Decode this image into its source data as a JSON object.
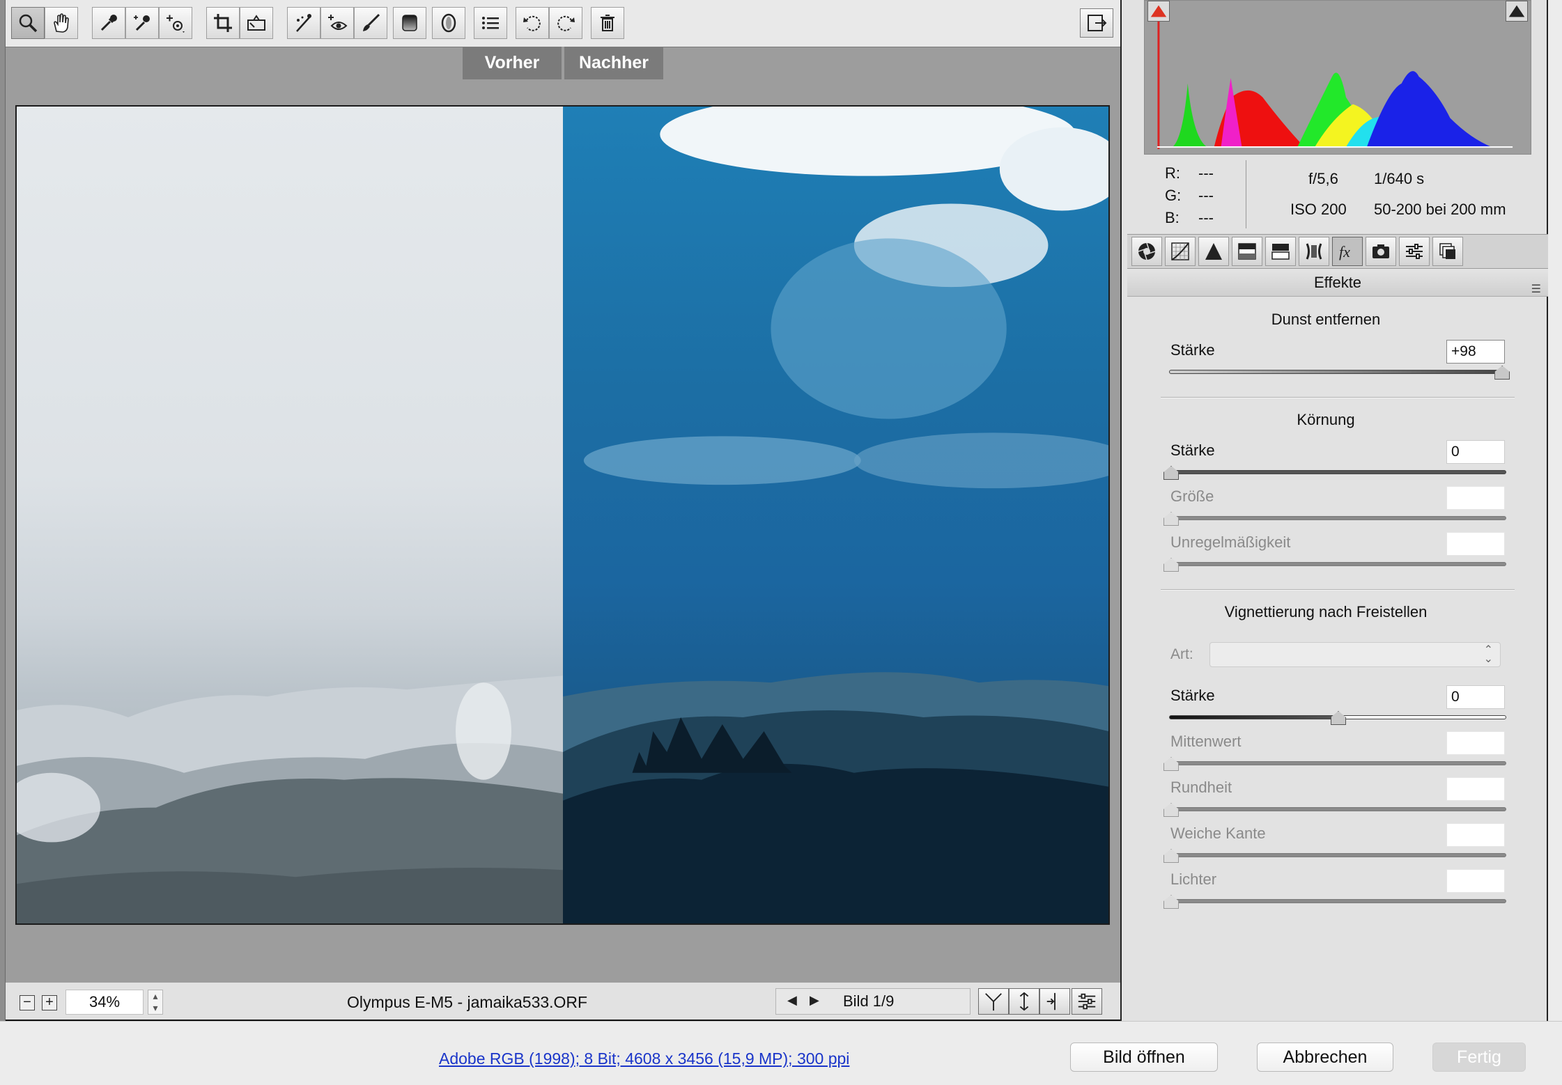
{
  "toolbar": {
    "tools": [
      "zoom-tool",
      "hand-tool",
      "white-balance-tool",
      "color-sampler-tool",
      "target-adjustment-tool",
      "crop-tool",
      "straighten-tool",
      "spot-removal-tool",
      "red-eye-tool",
      "adjustment-brush-tool",
      "graduated-filter-tool",
      "radial-filter-tool",
      "presets-list",
      "rotate-left",
      "rotate-right",
      "delete"
    ]
  },
  "preview": {
    "before_label": "Vorher",
    "after_label": "Nachher"
  },
  "status": {
    "zoom": "34%",
    "filename": "Olympus E-M5 - jamaika533.ORF",
    "image_count": "Bild 1/9"
  },
  "info": {
    "r_label": "R:",
    "r_value": "---",
    "g_label": "G:",
    "g_value": "---",
    "b_label": "B:",
    "b_value": "---",
    "aperture": "f/5,6",
    "shutter": "1/640 s",
    "iso": "ISO 200",
    "lens": "50-200 bei 200 mm"
  },
  "panel": {
    "title": "Effekte",
    "dehaze": {
      "title": "Dunst entfernen",
      "amount_label": "Stärke",
      "amount_value": "+98",
      "amount": 98
    },
    "grain": {
      "title": "Körnung",
      "amount_label": "Stärke",
      "amount_value": "0",
      "size_label": "Größe",
      "roughness_label": "Unregelmäßigkeit"
    },
    "vignette": {
      "title": "Vignettierung nach Freistellen",
      "style_label": "Art:",
      "amount_label": "Stärke",
      "amount_value": "0",
      "midpoint_label": "Mittenwert",
      "roundness_label": "Rundheit",
      "feather_label": "Weiche Kante",
      "highlights_label": "Lichter"
    }
  },
  "footer": {
    "info_link": "Adobe RGB (1998); 8 Bit; 4608 x 3456 (15,9 MP); 300 ppi",
    "open_button": "Bild öffnen",
    "cancel_button": "Abbrechen",
    "done_button": "Fertig"
  }
}
